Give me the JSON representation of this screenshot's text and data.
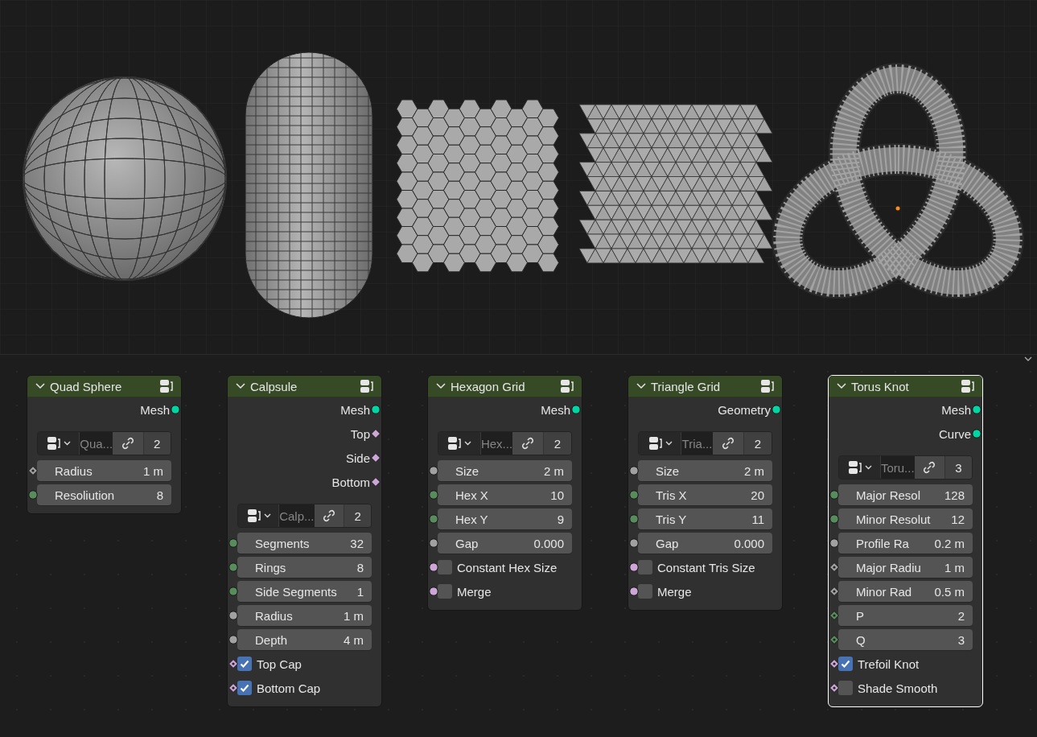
{
  "nodes": [
    {
      "title": "Quad Sphere",
      "selected": false,
      "outputs": [
        {
          "label": "Mesh",
          "socket": {
            "kind": "circle",
            "color": "#00d6a3"
          }
        }
      ],
      "group": {
        "name": "Qua...",
        "users": "2"
      },
      "inputs": [
        {
          "kind": "field",
          "label": "Radius",
          "value": "1 m",
          "socket": {
            "kind": "diamond-dot",
            "color": "#a1a1a1"
          }
        },
        {
          "kind": "field",
          "label": "Resoliution",
          "value": "8",
          "socket": {
            "kind": "circle",
            "color": "#598c5c"
          }
        }
      ]
    },
    {
      "title": "Calpsule",
      "selected": false,
      "outputs": [
        {
          "label": "Mesh",
          "socket": {
            "kind": "circle",
            "color": "#00d6a3"
          }
        },
        {
          "label": "Top",
          "socket": {
            "kind": "diamond",
            "color": "#cca6d6"
          }
        },
        {
          "label": "Side",
          "socket": {
            "kind": "diamond",
            "color": "#cca6d6"
          }
        },
        {
          "label": "Bottom",
          "socket": {
            "kind": "diamond",
            "color": "#cca6d6"
          }
        }
      ],
      "group": {
        "name": "Calp...",
        "users": "2"
      },
      "inputs": [
        {
          "kind": "field",
          "label": "Segments",
          "value": "32",
          "socket": {
            "kind": "circle",
            "color": "#598c5c"
          }
        },
        {
          "kind": "field",
          "label": "Rings",
          "value": "8",
          "socket": {
            "kind": "circle",
            "color": "#598c5c"
          }
        },
        {
          "kind": "field",
          "label": "Side Segments",
          "value": "1",
          "socket": {
            "kind": "circle",
            "color": "#598c5c"
          }
        },
        {
          "kind": "field",
          "label": "Radius",
          "value": "1 m",
          "socket": {
            "kind": "circle",
            "color": "#a1a1a1"
          }
        },
        {
          "kind": "field",
          "label": "Depth",
          "value": "4 m",
          "socket": {
            "kind": "circle",
            "color": "#a1a1a1"
          }
        },
        {
          "kind": "checkbox",
          "label": "Top Cap",
          "checked": true,
          "socket": {
            "kind": "diamond-dot",
            "color": "#cca6d6"
          }
        },
        {
          "kind": "checkbox",
          "label": "Bottom Cap",
          "checked": true,
          "socket": {
            "kind": "diamond-dot",
            "color": "#cca6d6"
          }
        }
      ]
    },
    {
      "title": "Hexagon Grid",
      "selected": false,
      "outputs": [
        {
          "label": "Mesh",
          "socket": {
            "kind": "circle",
            "color": "#00d6a3"
          }
        }
      ],
      "group": {
        "name": "Hex...",
        "users": "2"
      },
      "inputs": [
        {
          "kind": "field",
          "label": "Size",
          "value": "2 m",
          "socket": {
            "kind": "circle",
            "color": "#a1a1a1"
          }
        },
        {
          "kind": "field",
          "label": "Hex X",
          "value": "10",
          "socket": {
            "kind": "circle",
            "color": "#598c5c"
          }
        },
        {
          "kind": "field",
          "label": "Hex Y",
          "value": "9",
          "socket": {
            "kind": "circle",
            "color": "#598c5c"
          }
        },
        {
          "kind": "field",
          "label": "Gap",
          "value": "0.000",
          "socket": {
            "kind": "circle",
            "color": "#a1a1a1"
          }
        },
        {
          "kind": "checkbox",
          "label": "Constant Hex Size",
          "checked": false,
          "socket": {
            "kind": "circle",
            "color": "#cca6d6"
          }
        },
        {
          "kind": "checkbox",
          "label": "Merge",
          "checked": false,
          "socket": {
            "kind": "circle",
            "color": "#cca6d6"
          }
        }
      ]
    },
    {
      "title": "Triangle Grid",
      "selected": false,
      "outputs": [
        {
          "label": "Geometry",
          "socket": {
            "kind": "circle",
            "color": "#00d6a3"
          }
        }
      ],
      "group": {
        "name": "Tria...",
        "users": "2"
      },
      "inputs": [
        {
          "kind": "field",
          "label": "Size",
          "value": "2 m",
          "socket": {
            "kind": "circle",
            "color": "#a1a1a1"
          }
        },
        {
          "kind": "field",
          "label": "Tris X",
          "value": "20",
          "socket": {
            "kind": "circle",
            "color": "#598c5c"
          }
        },
        {
          "kind": "field",
          "label": "Tris Y",
          "value": "11",
          "socket": {
            "kind": "circle",
            "color": "#598c5c"
          }
        },
        {
          "kind": "field",
          "label": "Gap",
          "value": "0.000",
          "socket": {
            "kind": "circle",
            "color": "#a1a1a1"
          }
        },
        {
          "kind": "checkbox",
          "label": "Constant Tris Size",
          "checked": false,
          "socket": {
            "kind": "circle",
            "color": "#cca6d6"
          }
        },
        {
          "kind": "checkbox",
          "label": "Merge",
          "checked": false,
          "socket": {
            "kind": "circle",
            "color": "#cca6d6"
          }
        }
      ]
    },
    {
      "title": "Torus Knot",
      "selected": true,
      "outputs": [
        {
          "label": "Mesh",
          "socket": {
            "kind": "circle",
            "color": "#00d6a3"
          }
        },
        {
          "label": "Curve",
          "socket": {
            "kind": "circle",
            "color": "#00d6a3"
          }
        }
      ],
      "group": {
        "name": "Toru...",
        "users": "3"
      },
      "inputs": [
        {
          "kind": "field",
          "label": "Major Resol",
          "value": "128",
          "socket": {
            "kind": "circle",
            "color": "#598c5c"
          }
        },
        {
          "kind": "field",
          "label": "Minor Resolut",
          "value": "12",
          "socket": {
            "kind": "circle",
            "color": "#598c5c"
          }
        },
        {
          "kind": "field",
          "label": "Profile Ra",
          "value": "0.2 m",
          "socket": {
            "kind": "circle",
            "color": "#a1a1a1"
          }
        },
        {
          "kind": "field",
          "label": "Major Radiu",
          "value": "1 m",
          "socket": {
            "kind": "diamond-dot",
            "color": "#a1a1a1"
          }
        },
        {
          "kind": "field",
          "label": "Minor Rad",
          "value": "0.5 m",
          "socket": {
            "kind": "diamond-dot",
            "color": "#a1a1a1"
          }
        },
        {
          "kind": "field",
          "label": "P",
          "value": "2",
          "socket": {
            "kind": "diamond-dot",
            "color": "#598c5c"
          }
        },
        {
          "kind": "field",
          "label": "Q",
          "value": "3",
          "socket": {
            "kind": "diamond-dot",
            "color": "#598c5c"
          }
        },
        {
          "kind": "checkbox",
          "label": "Trefoil Knot",
          "checked": true,
          "socket": {
            "kind": "diamond-dot",
            "color": "#cca6d6"
          }
        },
        {
          "kind": "checkbox",
          "label": "Shade Smooth",
          "checked": false,
          "socket": {
            "kind": "diamond-dot",
            "color": "#cca6d6"
          }
        }
      ]
    }
  ]
}
